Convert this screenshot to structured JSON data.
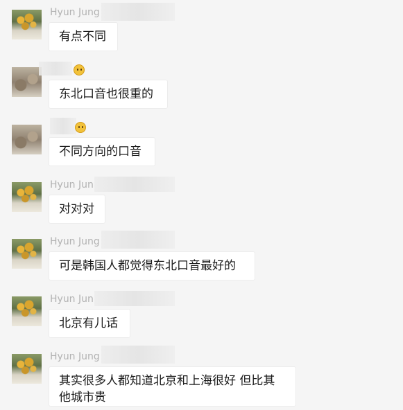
{
  "messages": [
    {
      "sender": "Hyun Jung",
      "text": "有点不同",
      "avatar": "flowers-avatar"
    },
    {
      "sender": "",
      "text": "东北口音也很重的",
      "avatar": "room-avatar"
    },
    {
      "sender": "",
      "text": "不同方向的口音",
      "avatar": "room-avatar"
    },
    {
      "sender": "Hyun Jun",
      "text": "对对对",
      "avatar": "flowers-avatar"
    },
    {
      "sender": "Hyun Jung",
      "text": "可是韩国人都觉得东北口音最好的",
      "avatar": "flowers-avatar"
    },
    {
      "sender": "Hyun Jun",
      "text": "北京有儿话",
      "avatar": "flowers-avatar"
    },
    {
      "sender": "Hyun Jung",
      "text": "其实很多人都知道北京和上海很好 但比其\n他城市贵",
      "avatar": "flowers-avatar"
    }
  ],
  "colors": {
    "background": "#f5f5f5",
    "bubble": "#ffffff",
    "sender_name": "#b2b2b2",
    "text": "#1a1a1a"
  },
  "icons": {
    "emoji": "smiley-emoji-icon"
  }
}
